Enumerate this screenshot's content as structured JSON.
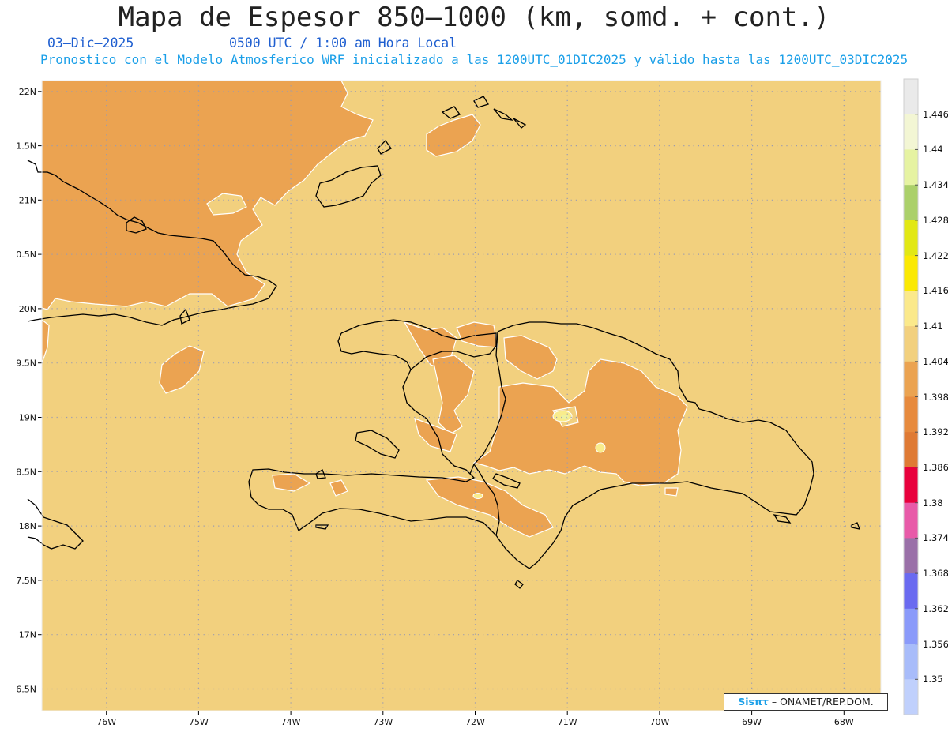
{
  "header": {
    "title": "Mapa de Espesor 850–1000 (km, somd. + cont.)",
    "date": "03–Dic–2025",
    "time": "0500 UTC / 1:00 am Hora Local",
    "model_line": "Pronostico con el Modelo Atmosferico WRF inicializado a las 1200UTC_01DIC2025 y válido hasta las  1200UTC_03DIC2025"
  },
  "map": {
    "lon_range": [
      -76.7,
      -67.6
    ],
    "lat_range": [
      16.3,
      22.1
    ],
    "lon_ticks": [
      {
        "value": -76,
        "label": "76W"
      },
      {
        "value": -75,
        "label": "75W"
      },
      {
        "value": -74,
        "label": "74W"
      },
      {
        "value": -73,
        "label": "73W"
      },
      {
        "value": -72,
        "label": "72W"
      },
      {
        "value": -71,
        "label": "71W"
      },
      {
        "value": -70,
        "label": "70W"
      },
      {
        "value": -69,
        "label": "69W"
      },
      {
        "value": -68,
        "label": "68W"
      }
    ],
    "lat_ticks": [
      {
        "value": 22,
        "label": "22N"
      },
      {
        "value": 21.5,
        "label": "1.5N"
      },
      {
        "value": 21,
        "label": "21N"
      },
      {
        "value": 20.5,
        "label": "0.5N"
      },
      {
        "value": 20,
        "label": "20N"
      },
      {
        "value": 19.5,
        "label": "9.5N"
      },
      {
        "value": 19,
        "label": "19N"
      },
      {
        "value": 18.5,
        "label": "8.5N"
      },
      {
        "value": 18,
        "label": "18N"
      },
      {
        "value": 17.5,
        "label": "7.5N"
      },
      {
        "value": 17,
        "label": "17N"
      },
      {
        "value": 16.5,
        "label": "6.5N"
      }
    ],
    "background_color": "#f2d07e",
    "high_thickness_color": "#eba351",
    "peak_colors": [
      "#f9ec8c",
      "#eef1a0"
    ],
    "coastline_color": "#000000",
    "grid": "dotted"
  },
  "colorbar": {
    "labels": [
      "1.446",
      "1.44",
      "1.434",
      "1.428",
      "1.422",
      "1.416",
      "1.41",
      "1.404",
      "1.398",
      "1.392",
      "1.386",
      "1.38",
      "1.374",
      "1.368",
      "1.362",
      "1.356",
      "1.35"
    ],
    "colors": [
      "#eaeaea",
      "#f3f6d4",
      "#e6f3a2",
      "#abd06a",
      "#e2e814",
      "#fbe903",
      "#fbe98b",
      "#f2d07e",
      "#eba351",
      "#e78a3d",
      "#df7a34",
      "#e8003c",
      "#e85aa8",
      "#9a70a8",
      "#6a6af0",
      "#8a9afa",
      "#a8bcfa",
      "#c0d0fc"
    ]
  },
  "credit": {
    "logo": "Sisπτ",
    "text": "– ONAMET/REP.DOM."
  }
}
